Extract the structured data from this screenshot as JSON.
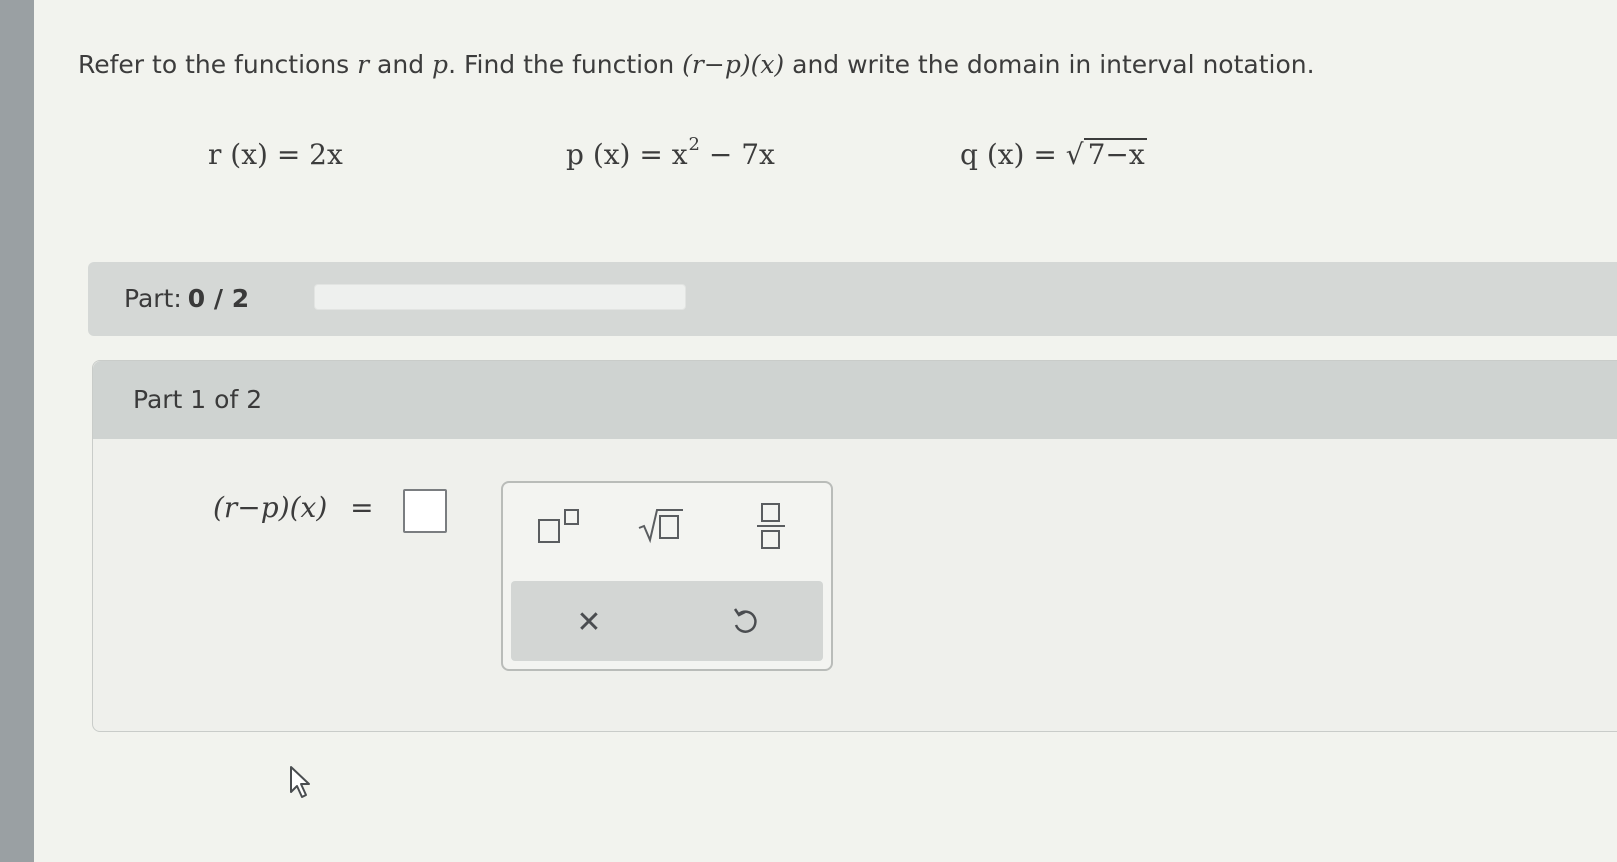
{
  "prompt": {
    "before": "Refer to the functions ",
    "var1": "r",
    "and": " and ",
    "var2": "p",
    "mid": ". Find the function ",
    "expr": "(r−p)(x)",
    "after": " and write the domain in interval notation."
  },
  "functions": {
    "r": {
      "lhs": "r (x) = 2x"
    },
    "p": {
      "lhs": "p (x) = x",
      "exp": "2",
      "rest": " − 7x"
    },
    "q": {
      "lhs": "q (x) = ",
      "radicand": "7−x"
    }
  },
  "part_bar": {
    "label": "Part:",
    "progress_text": "0 / 2",
    "progress": 0.0
  },
  "part": {
    "heading": "Part 1 of 2",
    "answer_lhs": "(r−p)(x)",
    "equals": "=",
    "answer_value": ""
  },
  "toolbox": {
    "tools": [
      {
        "icon": "superscript-template-icon"
      },
      {
        "icon": "square-root-template-icon"
      },
      {
        "icon": "fraction-template-icon"
      }
    ],
    "actions": [
      {
        "icon": "clear-x-icon",
        "glyph": "✕"
      },
      {
        "icon": "undo-icon"
      }
    ]
  },
  "colors": {
    "accent_box": "#7a7d80",
    "panel": "#d3d6d4"
  }
}
